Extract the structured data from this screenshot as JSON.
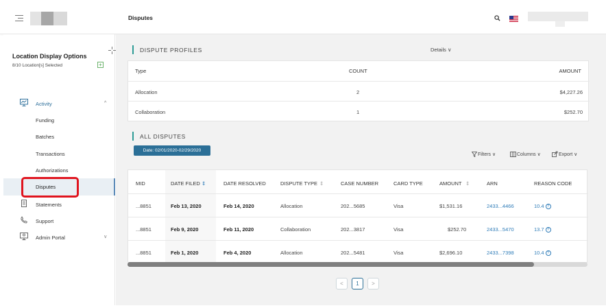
{
  "header": {
    "title": "Disputes"
  },
  "sidebar": {
    "location_title": "Location Display Options",
    "location_sub": "8/10 Location[s] Selected",
    "add_label": "+",
    "activity": {
      "label": "Activity",
      "chevron": "^"
    },
    "activity_items": [
      {
        "label": "Funding"
      },
      {
        "label": "Batches"
      },
      {
        "label": "Transactions"
      },
      {
        "label": "Authorizations"
      },
      {
        "label": "Disputes"
      }
    ],
    "statements": {
      "label": "Statements"
    },
    "support": {
      "label": "Support"
    },
    "admin": {
      "label": "Admin Portal",
      "chevron": "v"
    }
  },
  "profiles": {
    "section_title": "DISPUTE PROFILES",
    "details_label": "Details ∨",
    "headers": {
      "type": "Type",
      "count": "COUNT",
      "amount": "AMOUNT"
    },
    "rows": [
      {
        "type": "Allocation",
        "count": "2",
        "amount": "$4,227.26"
      },
      {
        "type": "Collaboration",
        "count": "1",
        "amount": "$252.70"
      }
    ]
  },
  "disputes": {
    "section_title": "ALL DISPUTES",
    "date_range": "Date: 02/01/2020-02/29/2020",
    "toolbar": {
      "filters": "Filters ∨",
      "columns": "Columns ∨",
      "export": "Export ∨"
    },
    "headers": {
      "mid": "MID",
      "date_filed": "DATE FILED",
      "date_resolved": "DATE RESOLVED",
      "dispute_type": "DISPUTE TYPE",
      "case_number": "CASE NUMBER",
      "card_type": "CARD TYPE",
      "amount": "AMOUNT",
      "arn": "ARN",
      "reason_code": "REASON CODE"
    },
    "rows": [
      {
        "mid": "...8851",
        "date_filed": "Feb 13, 2020",
        "date_resolved": "Feb 14, 2020",
        "dispute_type": "Allocation",
        "case_number": "202...5685",
        "card_type": "Visa",
        "amount": "$1,531.16",
        "arn": "2433...4466",
        "reason_code": "10.4"
      },
      {
        "mid": "...8851",
        "date_filed": "Feb 9, 2020",
        "date_resolved": "Feb 11, 2020",
        "dispute_type": "Collaboration",
        "case_number": "202...3817",
        "card_type": "Visa",
        "amount": "$252.70",
        "arn": "2433...5470",
        "reason_code": "13.7"
      },
      {
        "mid": "...8851",
        "date_filed": "Feb 1, 2020",
        "date_resolved": "Feb 4, 2020",
        "dispute_type": "Allocation",
        "case_number": "202...5481",
        "card_type": "Visa",
        "amount": "$2,696.10",
        "arn": "2433...7398",
        "reason_code": "10.4"
      }
    ]
  },
  "pagination": {
    "prev": "<",
    "current": "1",
    "next": ">"
  },
  "colors": {
    "accent": "#2b6f97",
    "section_bar": "#2e9c96",
    "link": "#2f7cb8",
    "highlight_box": "#e0141e"
  },
  "icons": [
    "menu-icon",
    "search-icon",
    "us-flag-icon",
    "move-icon",
    "add-icon",
    "monitor-icon",
    "document-icon",
    "phone-icon",
    "admin-icon",
    "filter-icon",
    "columns-icon",
    "export-icon",
    "help-icon",
    "sort-icon"
  ]
}
